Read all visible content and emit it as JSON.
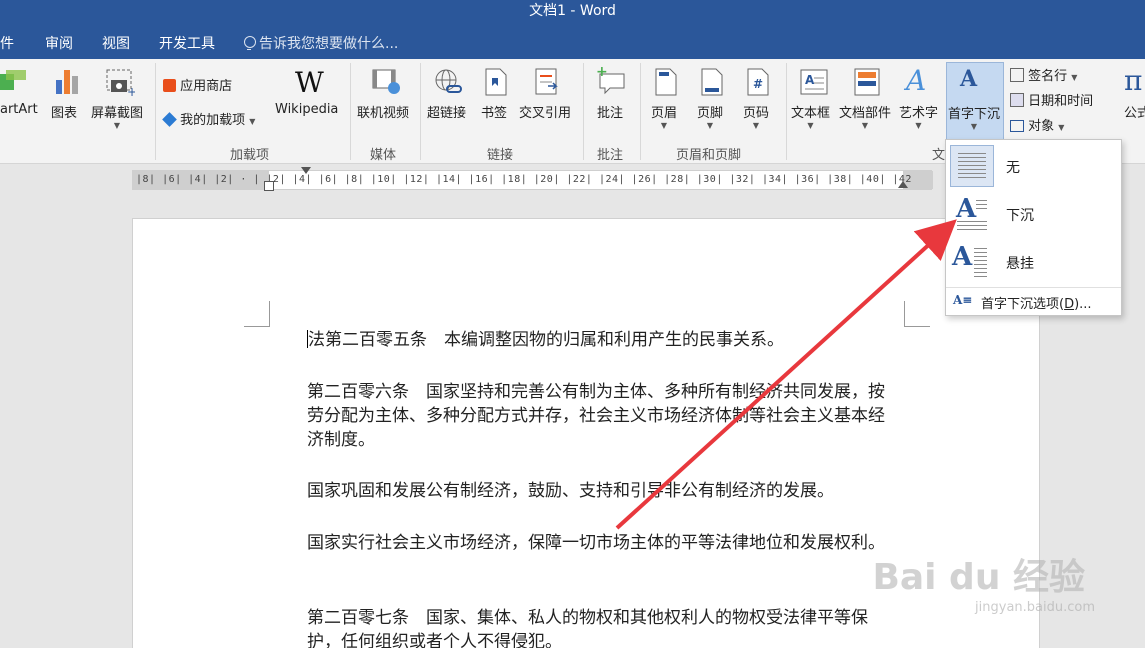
{
  "window": {
    "title": "文档1 - Word"
  },
  "menu": {
    "tabs": [
      "件",
      "审阅",
      "视图",
      "开发工具"
    ],
    "tell_me": "告诉我您想要做什么..."
  },
  "ribbon": {
    "buttons": {
      "smartart": "artArt",
      "chart": "图表",
      "screenshot": "屏幕截图",
      "store": "应用商店",
      "my_addins": "我的加载项",
      "wikipedia": "Wikipedia",
      "online_video": "联机视频",
      "hyperlink": "超链接",
      "bookmark": "书签",
      "cross_ref": "交叉引用",
      "comment": "批注",
      "header": "页眉",
      "footer": "页脚",
      "page_number": "页码",
      "text_box": "文本框",
      "quick_parts": "文档部件",
      "wordart": "艺术字",
      "drop_cap": "首字下沉",
      "signature_line": "签名行",
      "date_time": "日期和时间",
      "object": "对象",
      "equation": "公式"
    },
    "groups": {
      "addins": "加载项",
      "media": "媒体",
      "links": "链接",
      "comments": "批注",
      "header_footer": "页眉和页脚",
      "text_partial": "文"
    }
  },
  "ruler": {
    "ticks": "|8|  |6|  |4|  |2|  ·  |  |2|  |4|  |6|  |8| |10| |12| |14| |16| |18| |20| |22| |24| |26| |28| |30| |32| |34| |36| |38| |40| |42"
  },
  "dropdown": {
    "items": [
      {
        "label": "无",
        "selected": true
      },
      {
        "label": "下沉",
        "selected": false
      },
      {
        "label": "悬挂",
        "selected": false
      }
    ],
    "options_label": "首字下沉选项(",
    "options_key": "D",
    "options_suffix": ")..."
  },
  "document": {
    "paragraphs": [
      "法第二百零五条　本编调整因物的归属和利用产生的民事关系。",
      "第二百零六条　国家坚持和完善公有制为主体、多种所有制经济共同发展，按劳分配为主体、多种分配方式并存，社会主义市场经济体制等社会主义基本经济制度。",
      "国家巩固和发展公有制经济，鼓励、支持和引导非公有制经济的发展。",
      "国家实行社会主义市场经济，保障一切市场主体的平等法律地位和发展权利。",
      "第二百零七条　国家、集体、私人的物权和其他权利人的物权受法律平等保护，任何组织或者个人不得侵犯。"
    ]
  },
  "watermark": {
    "main": "Bai du 经验",
    "sub": "jingyan.baidu.com"
  },
  "colors": {
    "title_bar": "#2b579a",
    "arrow": "#e8383d",
    "accent": "#2b579a"
  }
}
